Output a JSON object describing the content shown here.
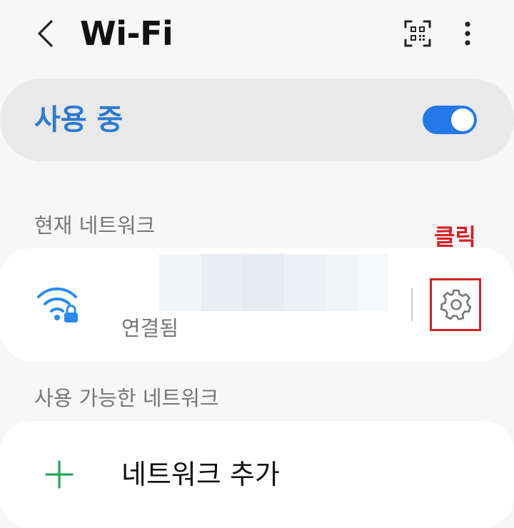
{
  "header": {
    "title": "Wi-Fi",
    "back_icon": "chevron-left-icon",
    "qr_icon": "qr-scan-icon",
    "more_icon": "more-vertical-icon"
  },
  "master_switch": {
    "label": "사용 중",
    "enabled": true,
    "accent_color": "#2478e8",
    "label_color": "#2a7bd2"
  },
  "current_network": {
    "section_title": "현재 네트워크",
    "status": "연결됨",
    "icon": "wifi-lock-icon",
    "settings_icon": "gear-icon"
  },
  "annotation": {
    "text": "클릭",
    "color": "#d81f26"
  },
  "available_networks": {
    "section_title": "사용 가능한 네트워크",
    "add_label": "네트워크 추가",
    "add_icon": "plus-icon"
  }
}
